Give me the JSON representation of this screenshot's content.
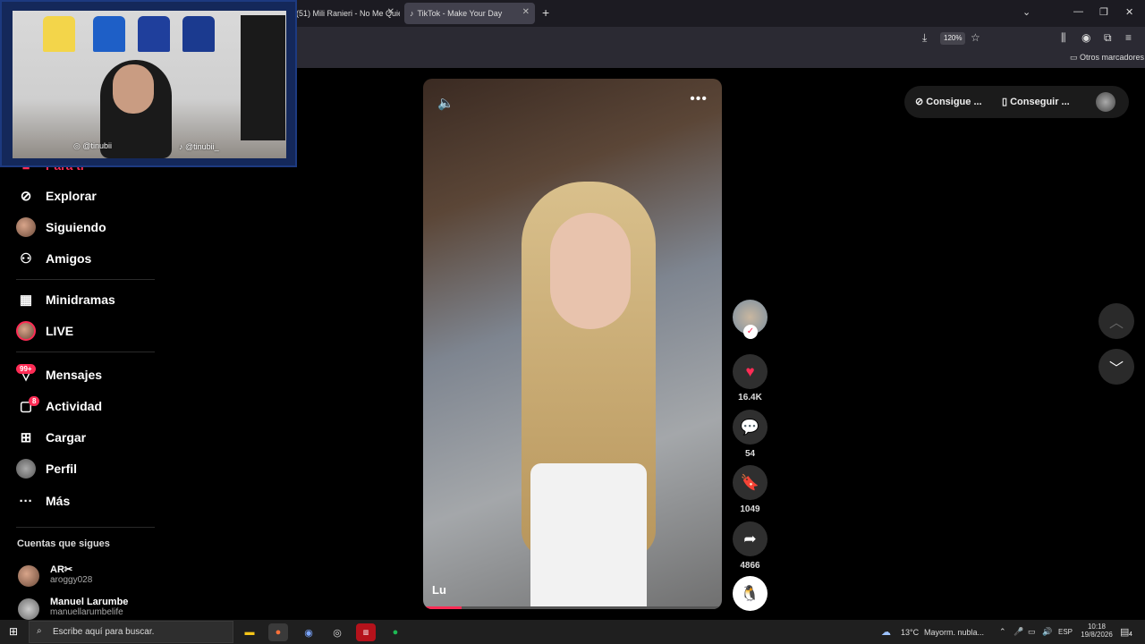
{
  "browser": {
    "tab1_title": "(51) Mili Ranieri - No Me Quie",
    "tab2_title": "TikTok - Make Your Day",
    "zoom": "120%",
    "bookmarks_label": "Otros marcadores"
  },
  "webcam": {
    "instagram_handle": "@tinubii",
    "tiktok_handle": "@tinubii_"
  },
  "sidebar": {
    "partial_item": "Para ti",
    "items": [
      {
        "label": "Explorar",
        "icon": "compass-icon"
      },
      {
        "label": "Siguiendo",
        "icon": "avatar-icon"
      },
      {
        "label": "Amigos",
        "icon": "friends-icon"
      },
      {
        "label": "Minidramas",
        "icon": "film-icon"
      },
      {
        "label": "LIVE",
        "icon": "live-avatar-icon"
      },
      {
        "label": "Mensajes",
        "icon": "message-icon",
        "badge": "99+"
      },
      {
        "label": "Actividad",
        "icon": "activity-icon",
        "badge": "8"
      },
      {
        "label": "Cargar",
        "icon": "upload-icon"
      },
      {
        "label": "Perfil",
        "icon": "profile-avatar-icon"
      },
      {
        "label": "Más",
        "icon": "more-icon"
      }
    ],
    "following_title": "Cuentas que sigues",
    "accounts": [
      {
        "name": "AR✂",
        "username": "aroggy028"
      },
      {
        "name": "Manuel Larumbe",
        "username": "manuellarumbelife"
      }
    ]
  },
  "video": {
    "caption": "Lu",
    "progress": 0.13
  },
  "actions": {
    "likes": "16.4K",
    "comments": "54",
    "saves": "1049",
    "shares": "4866"
  },
  "topright": {
    "btn1": "Consigue ...",
    "btn2": "Conseguir ..."
  },
  "taskbar": {
    "search_placeholder": "Escribe aquí para buscar.",
    "temperature": "13°C",
    "weather": "Mayorm. nubla...",
    "language": "ESP",
    "time": "10:18",
    "date": "19/8/2026",
    "notifications": "4"
  },
  "colors": {
    "accent": "#fe2c55",
    "save": "#facd00"
  }
}
